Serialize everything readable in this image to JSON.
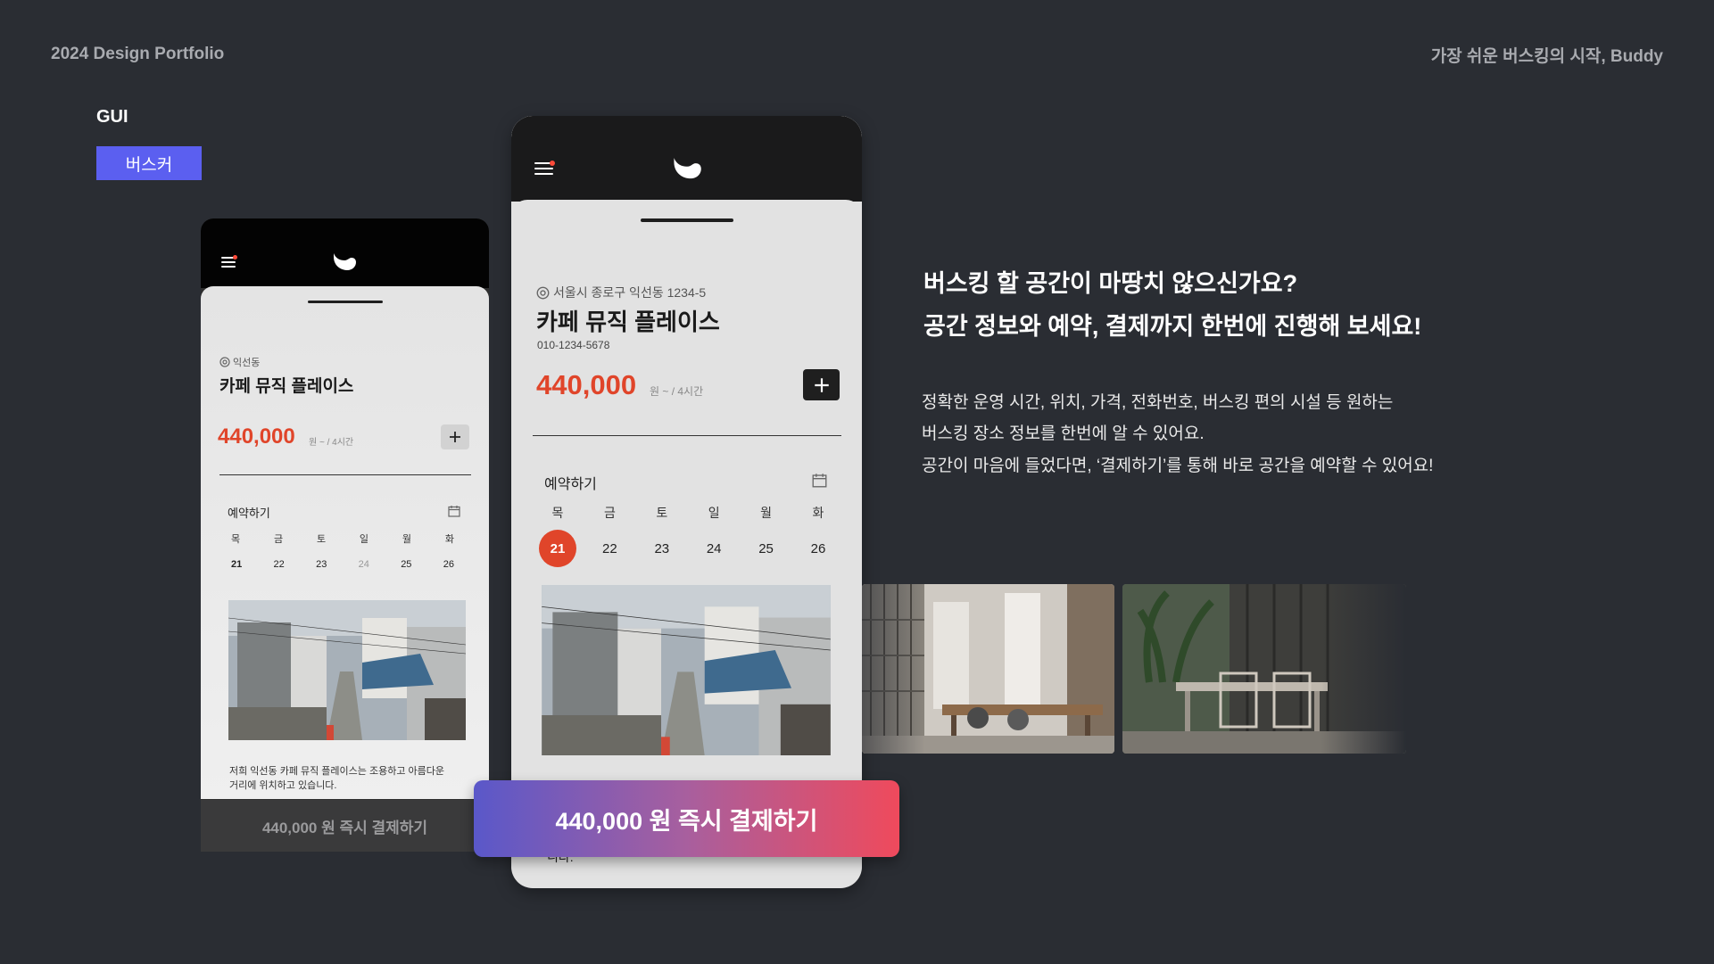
{
  "header": {
    "portfolio_label": "2024 Design Portfolio",
    "tagline": "가장 쉬운 버스킹의 시작, Buddy"
  },
  "section": {
    "label": "GUI",
    "tag": "버스커"
  },
  "phone_small": {
    "location": "익선동",
    "venue_name": "카페 뮤직 플레이스",
    "price": "440,000",
    "price_unit": "원 ~ / 4시간",
    "reserve_label": "예약하기",
    "weekdays": [
      "목",
      "금",
      "토",
      "일",
      "월",
      "화"
    ],
    "dates": [
      "21",
      "22",
      "23",
      "24",
      "25",
      "26"
    ],
    "description_line1": "저희 익선동 카페 뮤직 플레이스는 조용하고 아름다운",
    "description_line2": "거리에 위치하고 있습니다.",
    "pay_button": "440,000 원 즉시 결제하기"
  },
  "phone_big": {
    "address": "서울시 종로구 익선동 1234-5",
    "venue_name": "카페 뮤직 플레이스",
    "phone": "010-1234-5678",
    "price": "440,000",
    "price_unit": "원 ~ / 4시간",
    "reserve_label": "예약하기",
    "weekdays": [
      "목",
      "금",
      "토",
      "일",
      "월",
      "화"
    ],
    "dates": [
      "21",
      "22",
      "23",
      "24",
      "25",
      "26"
    ],
    "bottom_fragment": "니다.",
    "pay_button": "440,000 원 즉시 결제하기"
  },
  "copy": {
    "headline_line1": "버스킹 할 공간이 마땅치 않으신가요?",
    "headline_line2": "공간 정보와 예약, 결제까지 한번에 진행해 보세요!",
    "desc_line1": "정확한 운영 시간, 위치, 가격, 전화번호, 버스킹 편의 시설 등 원하는",
    "desc_line2": "버스킹 장소 정보를 한번에 알 수 있어요.",
    "desc_line3": "공간이 마음에 들었다면, ‘결제하기’를 통해 바로 공간을 예약할 수 있어요!"
  },
  "colors": {
    "background": "#2a2d33",
    "accent_purple": "#5b5ff0",
    "price_red": "#e0452a",
    "gradient_start": "#5a58c9",
    "gradient_end": "#ef4a5c"
  },
  "icons": [
    "menu-icon",
    "bird-logo-icon",
    "location-pin-icon",
    "plus-icon",
    "calendar-icon"
  ]
}
